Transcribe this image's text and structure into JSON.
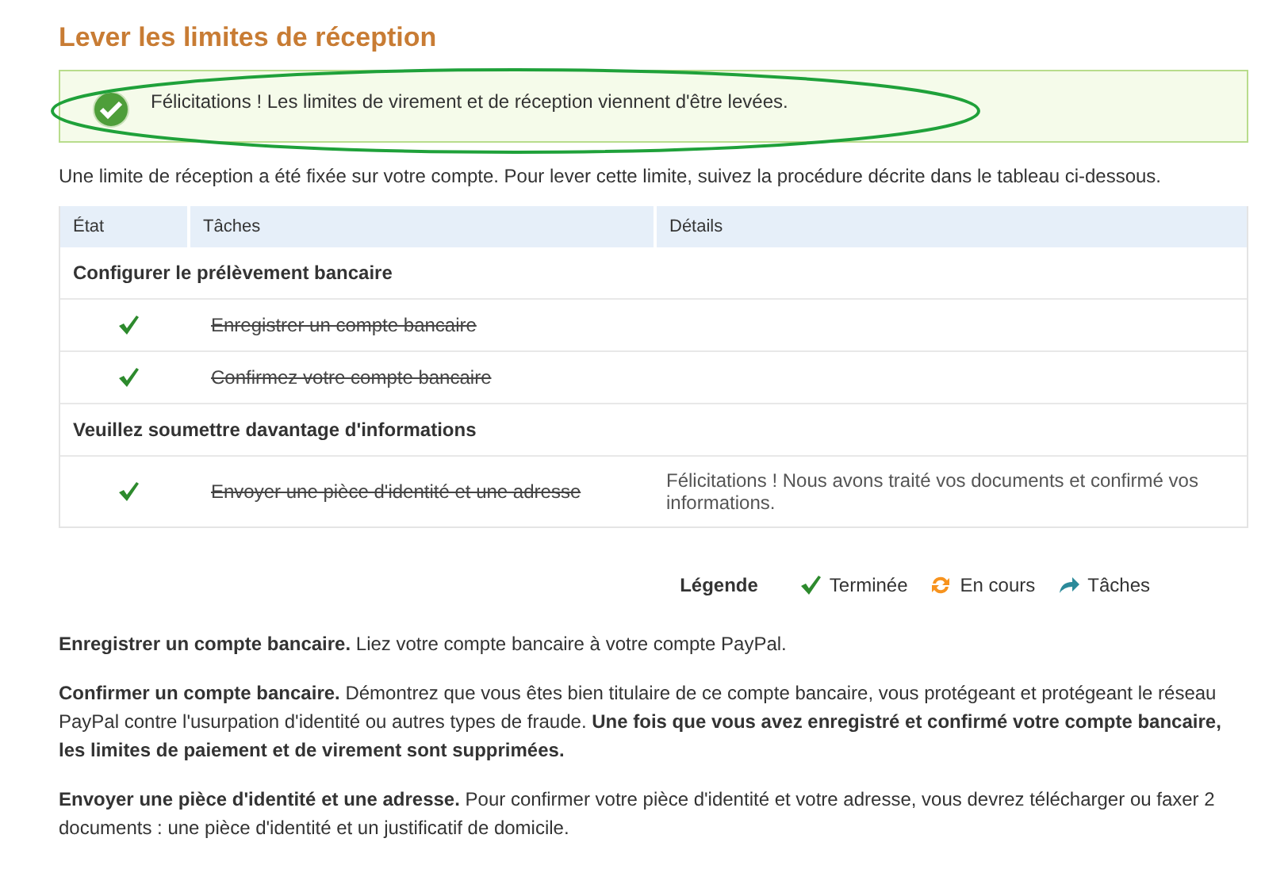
{
  "title": "Lever les limites de réception",
  "alert": {
    "message": "Félicitations ! Les limites de virement et de réception viennent d'être levées."
  },
  "intro": "Une limite de réception a été fixée sur votre compte. Pour lever cette limite, suivez la procédure décrite dans le tableau ci-dessous.",
  "table": {
    "columns": [
      "État",
      "Tâches",
      "Détails"
    ],
    "sections": [
      {
        "heading": "Configurer le prélèvement bancaire",
        "tasks": [
          {
            "task": "Enregistrer un compte bancaire",
            "done": true
          },
          {
            "task": "Confirmez votre compte bancaire",
            "done": true
          }
        ]
      },
      {
        "heading": "Veuillez soumettre davantage d'informations",
        "tasks": [
          {
            "task": "Envoyer une pièce d'identité et une adresse",
            "done": true,
            "details": "Félicitations ! Nous avons traité vos documents et confirmé vos informations."
          }
        ]
      }
    ]
  },
  "legend": {
    "label": "Légende",
    "items": [
      {
        "kind": "done",
        "label": "Terminée"
      },
      {
        "kind": "in_progress",
        "label": "En cours"
      },
      {
        "kind": "task",
        "label": "Tâches"
      }
    ]
  },
  "notes": [
    "**Enregistrer un compte bancaire.** Liez votre compte bancaire à votre compte PayPal.",
    "**Confirmer un compte bancaire.** Démontrez que vous êtes bien titulaire de ce compte bancaire, vous protégeant et protégeant le réseau PayPal contre l'usurpation d'identité ou autres types de fraude. **Une fois que vous avez enregistré et confirmé votre compte bancaire, les limites de paiement et de virement sont supprimées.**",
    "**Envoyer une pièce d'identité et une adresse.** Pour confirmer votre pièce d'identité et votre adresse, vous devrez télécharger ou faxer 2 documents : une pièce d'identité et un justificatif de domicile."
  ]
}
